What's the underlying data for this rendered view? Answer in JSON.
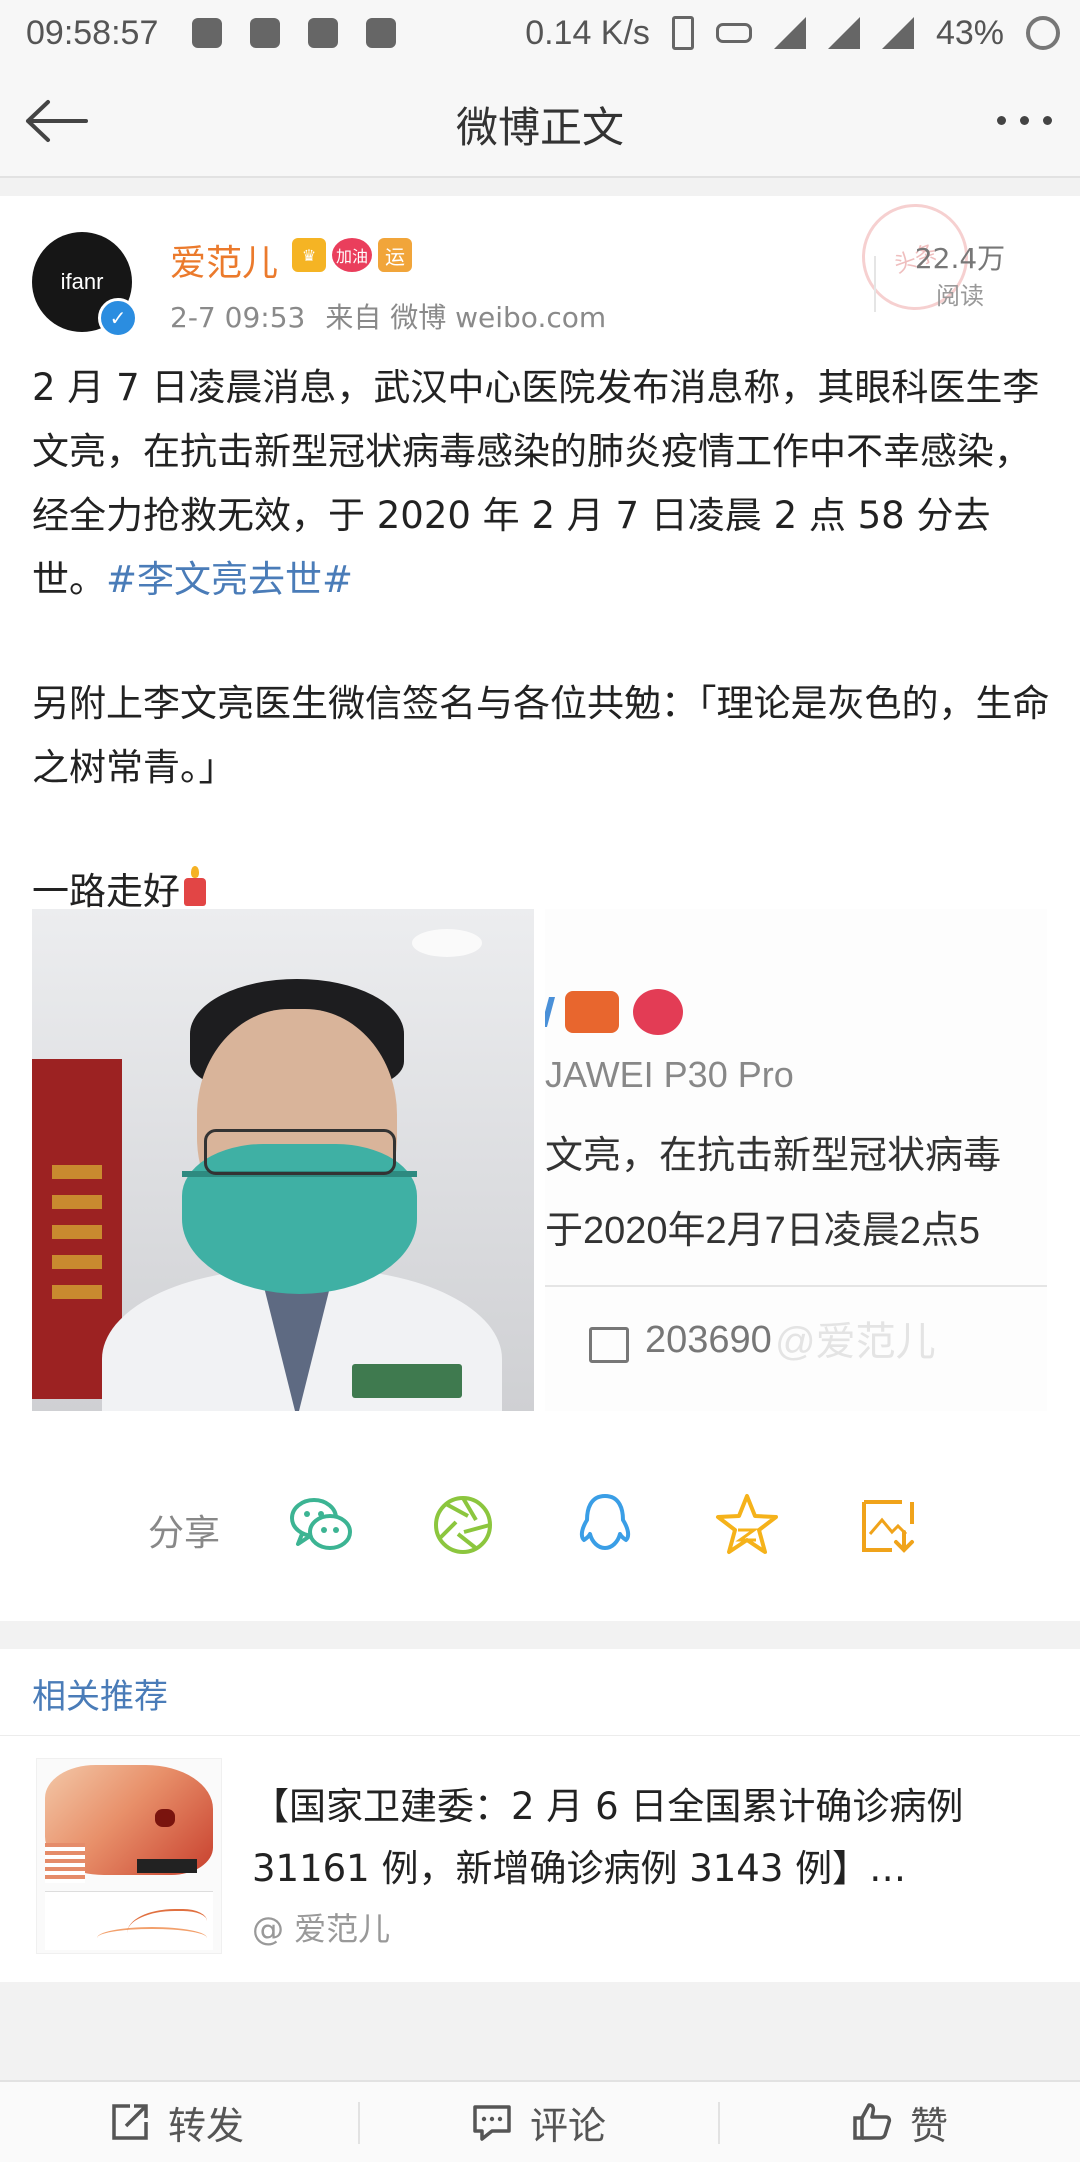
{
  "status_bar": {
    "time": "09:58:57",
    "speed": "0.14 K/s",
    "battery": "43%"
  },
  "nav": {
    "title": "微博正文"
  },
  "post": {
    "author": "爱范儿",
    "avatar_text": "ifanr",
    "badge_heart_text": "加油",
    "badge_yun_text": "运",
    "time": "2-7 09:53",
    "source": "来自 微博 weibo.com",
    "stamp_text": "头条",
    "read_count": "22.4万",
    "read_label": "阅读",
    "text_para1": "2 月 7 日凌晨消息，武汉中心医院发布消息称，其眼科医生李文亮，在抗击新型冠状病毒感染的肺炎疫情工作中不幸感染，经全力抢救无效，于 2020 年 2 月 7 日凌晨 2 点 58 分去世。",
    "hashtag": "#李文亮去世#",
    "text_para2": "另附上李文亮医生微信签名与各位共勉：「理论是灰色的，生命之树常青。」",
    "text_para3": "一路走好",
    "screenshot_line1": "JAWEI P30 Pro",
    "screenshot_line2": "文亮，在抗击新型冠状病毒",
    "screenshot_line3": "于2020年2月7日凌晨2点5",
    "screenshot_share_count": "203690",
    "screenshot_watermark": "@爱范儿"
  },
  "share": {
    "label": "分享",
    "targets": [
      "wechat-icon",
      "moments-icon",
      "qq-icon",
      "qzone-icon",
      "save-image-icon"
    ]
  },
  "related": {
    "title": "相关推荐",
    "items": [
      {
        "text": "【国家卫建委：2 月 6 日全国累计确诊病例 31161 例，新增确诊病例 3143 例】…",
        "source": "@ 爱范儿"
      }
    ]
  },
  "bottom_bar": {
    "repost": "转发",
    "comment": "评论",
    "like": "赞"
  },
  "colors": {
    "accent_blue": "#4a7cb8",
    "author_orange": "#eb7a2c",
    "wechat_green": "#3cb493",
    "qq_blue": "#3a9ee6",
    "star_yellow": "#f5b21a"
  }
}
